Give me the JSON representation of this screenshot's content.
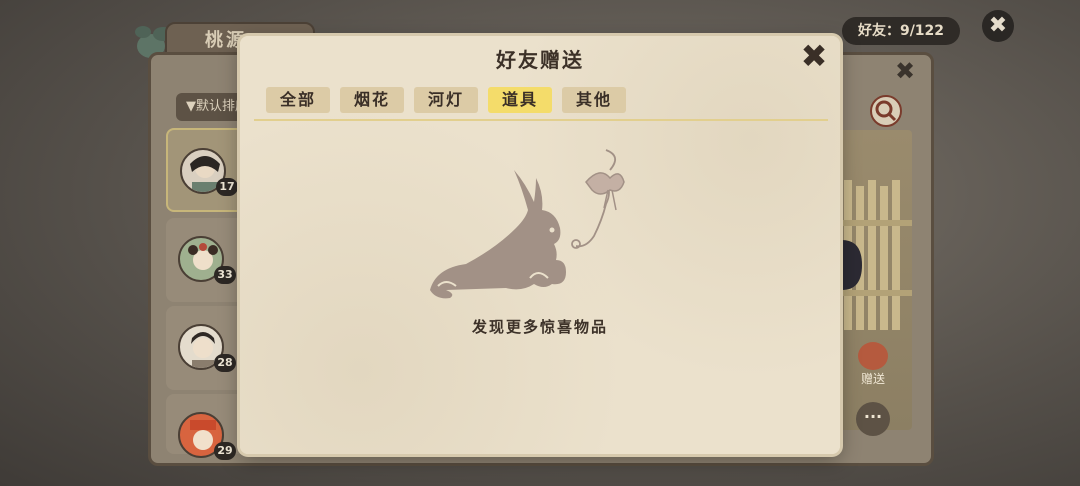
{
  "background": {
    "tab_label": "桃源",
    "friend_count": "好友：9/122",
    "sort_label": "▼默认排序",
    "friends": [
      {
        "level": "17",
        "selected": true
      },
      {
        "level": "33",
        "selected": false
      },
      {
        "level": "28",
        "selected": false
      },
      {
        "level": "29",
        "selected": false
      }
    ],
    "gift_label": "赠送"
  },
  "modal": {
    "title": "好友赠送",
    "tabs": [
      {
        "label": "全部",
        "active": false
      },
      {
        "label": "烟花",
        "active": false
      },
      {
        "label": "河灯",
        "active": false
      },
      {
        "label": "道具",
        "active": true
      },
      {
        "label": "其他",
        "active": false
      }
    ],
    "empty_message": "发现更多惊喜物品"
  },
  "icons": {
    "close": "close-icon",
    "search": "search-icon",
    "more": "more-icon",
    "rabbit": "rabbit-illustration"
  },
  "colors": {
    "active_tab": "#f4dc6a",
    "tab": "#dccba6",
    "modal_bg": "#ebe1cc",
    "text_dark": "#3c3128"
  }
}
